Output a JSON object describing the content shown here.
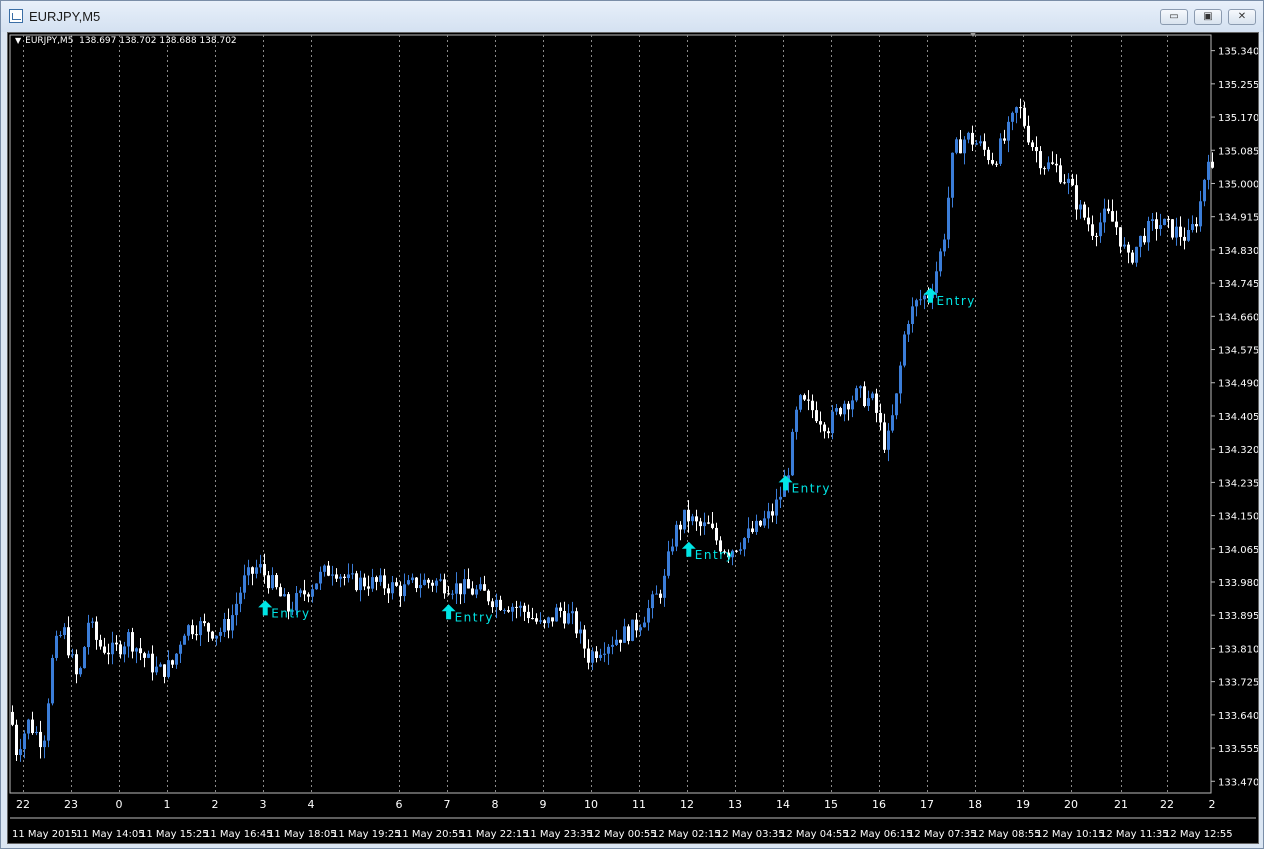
{
  "window": {
    "title": "EURJPY,M5",
    "buttons": {
      "minimize": "▭",
      "maximize": "▣",
      "close": "✕"
    }
  },
  "chart_header": {
    "symbol": "EURJPY,M5",
    "open": "138.697",
    "high": "138.702",
    "low": "138.688",
    "close": "138.702"
  },
  "chart_data": {
    "type": "candlestick",
    "bg_color": "#000000",
    "grid_color": "#8a8a8a",
    "bull_color": "#3b7dd8",
    "bear_color": "#ffffff",
    "signal_color": "#00e5e5",
    "ylim": [
      133.44,
      135.38
    ],
    "y_ticks": [
      "135.340",
      "135.255",
      "135.170",
      "135.085",
      "135.000",
      "134.915",
      "134.830",
      "134.745",
      "134.660",
      "134.575",
      "134.490",
      "134.405",
      "134.320",
      "134.235",
      "134.150",
      "134.065",
      "133.980",
      "133.895",
      "133.810",
      "133.725",
      "133.640",
      "133.555",
      "133.470"
    ],
    "hour_labels": [
      "22",
      "23",
      "0",
      "1",
      "2",
      "3",
      "4",
      "6",
      "7",
      "8",
      "9",
      "10",
      "11",
      "12",
      "13",
      "14",
      "15",
      "16",
      "17",
      "18",
      "19",
      "20",
      "21",
      "22",
      "2"
    ],
    "date_labels": [
      "11 May 2015",
      "11 May 14:05",
      "11 May 15:25",
      "11 May 16:45",
      "11 May 18:05",
      "11 May 19:25",
      "11 May 20:55",
      "11 May 22:15",
      "11 May 23:35",
      "12 May 00:55",
      "12 May 02:15",
      "12 May 03:35",
      "12 May 04:55",
      "12 May 06:15",
      "12 May 07:35",
      "12 May 08:55",
      "12 May 10:15",
      "12 May 11:35",
      "12 May 12:55"
    ],
    "price_path": [
      [
        0,
        133.68
      ],
      [
        8,
        133.55
      ],
      [
        20,
        133.62
      ],
      [
        35,
        133.57
      ],
      [
        45,
        133.8
      ],
      [
        55,
        133.86
      ],
      [
        70,
        133.72
      ],
      [
        80,
        133.88
      ],
      [
        90,
        133.82
      ],
      [
        105,
        133.8
      ],
      [
        120,
        133.84
      ],
      [
        135,
        133.79
      ],
      [
        150,
        133.75
      ],
      [
        165,
        133.77
      ],
      [
        175,
        133.86
      ],
      [
        190,
        133.87
      ],
      [
        210,
        133.85
      ],
      [
        222,
        133.88
      ],
      [
        235,
        133.98
      ],
      [
        250,
        134.02
      ],
      [
        265,
        133.97
      ],
      [
        280,
        133.91
      ],
      [
        295,
        133.95
      ],
      [
        310,
        133.99
      ],
      [
        325,
        134.02
      ],
      [
        340,
        133.98
      ],
      [
        360,
        133.98
      ],
      [
        380,
        133.97
      ],
      [
        395,
        133.96
      ],
      [
        410,
        133.98
      ],
      [
        430,
        133.98
      ],
      [
        445,
        133.97
      ],
      [
        460,
        133.96
      ],
      [
        475,
        133.95
      ],
      [
        490,
        133.93
      ],
      [
        505,
        133.92
      ],
      [
        520,
        133.9
      ],
      [
        535,
        133.86
      ],
      [
        550,
        133.91
      ],
      [
        565,
        133.88
      ],
      [
        580,
        133.79
      ],
      [
        595,
        133.82
      ],
      [
        610,
        133.84
      ],
      [
        625,
        133.86
      ],
      [
        640,
        133.91
      ],
      [
        655,
        133.97
      ],
      [
        665,
        134.1
      ],
      [
        678,
        134.15
      ],
      [
        690,
        134.12
      ],
      [
        700,
        134.12
      ],
      [
        710,
        134.08
      ],
      [
        720,
        134.06
      ],
      [
        735,
        134.09
      ],
      [
        750,
        134.12
      ],
      [
        765,
        134.16
      ],
      [
        778,
        134.24
      ],
      [
        790,
        134.44
      ],
      [
        805,
        134.42
      ],
      [
        820,
        134.38
      ],
      [
        835,
        134.44
      ],
      [
        850,
        134.46
      ],
      [
        865,
        134.44
      ],
      [
        878,
        134.32
      ],
      [
        888,
        134.45
      ],
      [
        898,
        134.65
      ],
      [
        910,
        134.7
      ],
      [
        922,
        134.72
      ],
      [
        935,
        134.85
      ],
      [
        945,
        135.08
      ],
      [
        958,
        135.12
      ],
      [
        970,
        135.1
      ],
      [
        985,
        135.06
      ],
      [
        998,
        135.12
      ],
      [
        1010,
        135.2
      ],
      [
        1022,
        135.11
      ],
      [
        1035,
        135.05
      ],
      [
        1048,
        135.04
      ],
      [
        1060,
        135.0
      ],
      [
        1072,
        134.93
      ],
      [
        1085,
        134.88
      ],
      [
        1098,
        134.92
      ],
      [
        1108,
        134.89
      ],
      [
        1120,
        134.8
      ],
      [
        1135,
        134.87
      ],
      [
        1150,
        134.9
      ],
      [
        1165,
        134.88
      ],
      [
        1180,
        134.86
      ],
      [
        1190,
        134.92
      ],
      [
        1200,
        135.08
      ],
      [
        1204,
        135.02
      ]
    ],
    "signals": [
      {
        "x_frac": 0.2125,
        "price": 133.91,
        "label": "Entry"
      },
      {
        "x_frac": 0.3652,
        "price": 133.9,
        "label": "Entry"
      },
      {
        "x_frac": 0.5652,
        "price": 134.06,
        "label": "Entry"
      },
      {
        "x_frac": 0.6458,
        "price": 134.23,
        "label": "Entry"
      },
      {
        "x_frac": 0.7664,
        "price": 134.71,
        "label": "Entry"
      }
    ]
  }
}
